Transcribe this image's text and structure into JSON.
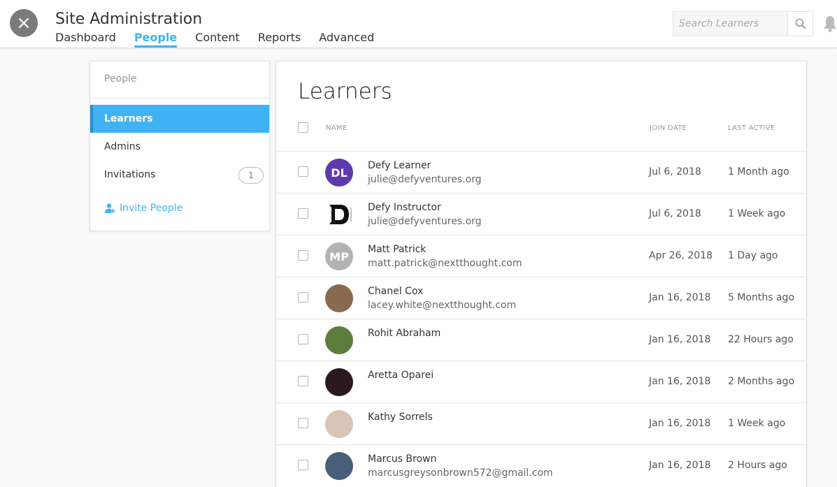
{
  "header": {
    "title": "Site Administration",
    "tabs": [
      "Dashboard",
      "People",
      "Content",
      "Reports",
      "Advanced"
    ],
    "active_tab": "People",
    "search_placeholder": "Search Learners"
  },
  "sidebar": {
    "title": "People",
    "items": [
      {
        "label": "Learners",
        "active": true
      },
      {
        "label": "Admins",
        "active": false
      },
      {
        "label": "Invitations",
        "badge": "1",
        "active": false
      }
    ],
    "invite_label": "Invite People"
  },
  "main": {
    "title": "Learners",
    "columns": {
      "name": "NAME",
      "join_date": "JOIN DATE",
      "last_active": "LAST ACTIVE"
    },
    "rows": [
      {
        "initials": "DL",
        "avatar_color": "#5e3aad",
        "name": "Defy Learner",
        "email": "julie@defyventures.org",
        "join_date": "Jul 6, 2018",
        "last_active": "1 Month ago"
      },
      {
        "initials": "D",
        "avatar_color": "#ffffff",
        "name": "Defy Instructor",
        "email": "julie@defyventures.org",
        "join_date": "Jul 6, 2018",
        "last_active": "1 Week ago"
      },
      {
        "initials": "MP",
        "avatar_color": "#b3b3b3",
        "name": "Matt Patrick",
        "email": "matt.patrick@nextthought.com",
        "join_date": "Apr 26, 2018",
        "last_active": "1 Day ago"
      },
      {
        "initials": "",
        "avatar_color": "#8a6a4f",
        "name": "Chanel Cox",
        "email": "lacey.white@nextthought.com",
        "join_date": "Jan 16, 2018",
        "last_active": "5 Months ago"
      },
      {
        "initials": "",
        "avatar_color": "#5c7d3c",
        "name": "Rohit Abraham",
        "email": "",
        "join_date": "Jan 16, 2018",
        "last_active": "22 Hours ago"
      },
      {
        "initials": "",
        "avatar_color": "#2a1a1f",
        "name": "Aretta Oparei",
        "email": "",
        "join_date": "Jan 16, 2018",
        "last_active": "2 Months ago"
      },
      {
        "initials": "",
        "avatar_color": "#d9c4b8",
        "name": "Kathy Sorrels",
        "email": "",
        "join_date": "Jan 16, 2018",
        "last_active": "1 Week ago"
      },
      {
        "initials": "",
        "avatar_color": "#4a5e7a",
        "name": "Marcus Brown",
        "email": "marcusgreysonbrown572@gmail.com",
        "join_date": "Jan 16, 2018",
        "last_active": "2 Hours ago"
      }
    ]
  },
  "colors": {
    "accent": "#3fb3f6",
    "close_button": "#7a7a7a"
  }
}
